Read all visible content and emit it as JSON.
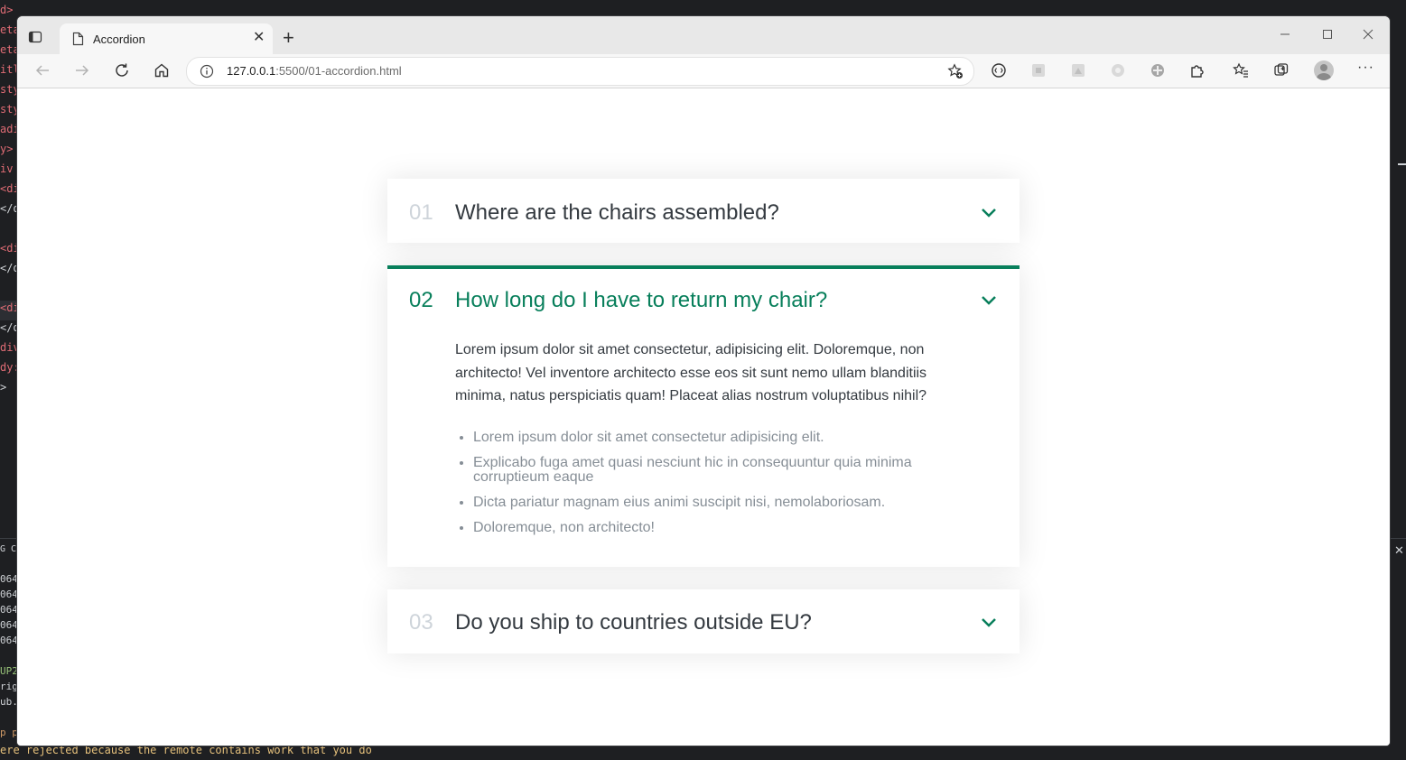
{
  "editor_left_snippets": [
    "d>",
    "eta",
    "eta",
    "itl",
    "sty",
    "sty",
    "adi",
    "y>",
    "iv",
    "<di",
    "</d",
    "<di",
    "</d",
    "<di",
    "</d",
    "div",
    "dy:",
    ">",
    "G CO",
    "064",
    "064",
    "064",
    "064",
    "064",
    "UP2",
    "rig",
    "ub.",
    "p p"
  ],
  "editor_bottom_text": "ere rejected because the remote contains work that you do",
  "browser": {
    "tab_title": "Accordion",
    "url_host": "127.0.0.1",
    "url_rest": ":5500/01-accordion.html"
  },
  "accordion": {
    "accent_color": "#087f5b",
    "items": [
      {
        "number": "01",
        "question": "Where are the chairs assembled?",
        "open": false
      },
      {
        "number": "02",
        "question": "How long do I have to return my chair?",
        "open": true,
        "answer": "Lorem ipsum dolor sit amet consectetur, adipisicing elit. Doloremque, non architecto! Vel inventore architecto esse eos sit sunt nemo ullam blanditiis minima, natus perspiciatis quam! Placeat alias nostrum voluptatibus nihil?",
        "list": [
          "Lorem ipsum dolor sit amet consectetur adipisicing elit.",
          "Explicabo fuga amet quasi nesciunt hic in consequuntur quia minima corruptieum eaque",
          "Dicta pariatur magnam eius animi suscipit nisi, nemolaboriosam.",
          "Doloremque, non architecto!"
        ]
      },
      {
        "number": "03",
        "question": "Do you ship to countries outside EU?",
        "open": false
      }
    ]
  }
}
